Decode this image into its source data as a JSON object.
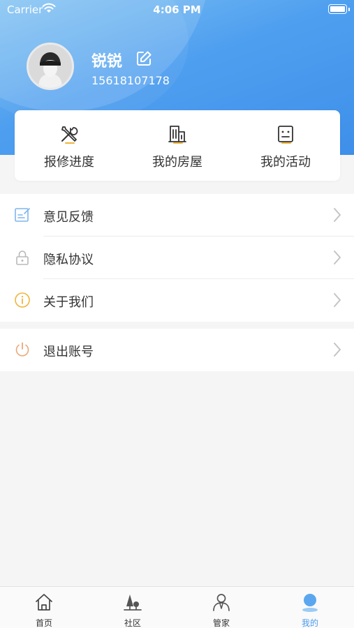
{
  "status_bar": {
    "carrier": "Carrier",
    "time": "4:06 PM"
  },
  "profile": {
    "name": "锐锐",
    "phone": "15618107178"
  },
  "quick_actions": [
    {
      "label": "报修进度",
      "icon": "repair-tools-icon"
    },
    {
      "label": "我的房屋",
      "icon": "building-icon"
    },
    {
      "label": "我的活动",
      "icon": "activity-board-icon"
    }
  ],
  "menu": [
    {
      "label": "意见反馈",
      "icon": "feedback-icon"
    },
    {
      "label": "隐私协议",
      "icon": "lock-icon"
    },
    {
      "label": "关于我们",
      "icon": "info-icon"
    }
  ],
  "logout": {
    "label": "退出账号",
    "icon": "power-icon"
  },
  "tabbar": [
    {
      "label": "首页",
      "icon": "home-icon"
    },
    {
      "label": "社区",
      "icon": "community-icon"
    },
    {
      "label": "管家",
      "icon": "butler-icon"
    },
    {
      "label": "我的",
      "icon": "profile-icon"
    }
  ],
  "colors": {
    "accent": "#4a9bec",
    "header_top": "#7ec1f3",
    "header_bottom": "#3e8fe9"
  }
}
